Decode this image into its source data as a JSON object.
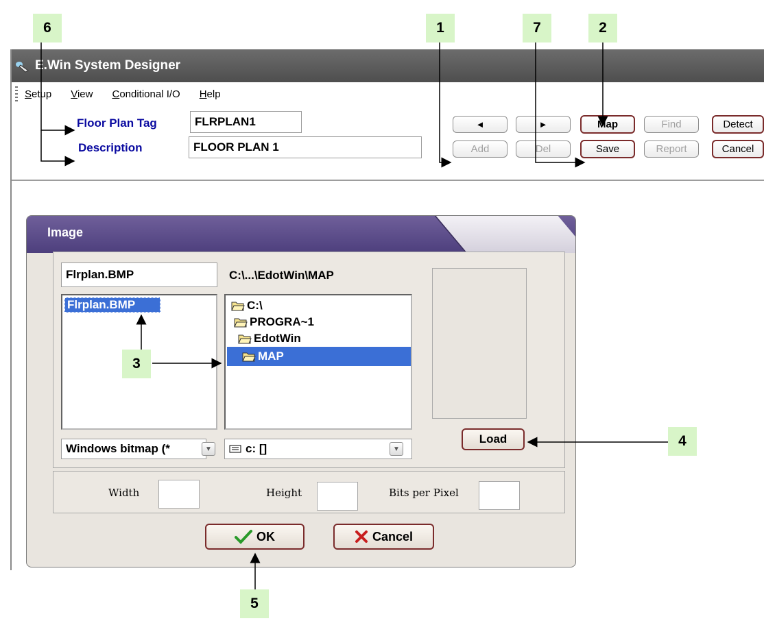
{
  "app": {
    "title": "E.Win System Designer",
    "menu": [
      {
        "ul": "S",
        "rest": "etup"
      },
      {
        "ul": "V",
        "rest": "iew"
      },
      {
        "ul": "C",
        "rest": "onditional I/O"
      },
      {
        "ul": "H",
        "rest": "elp"
      }
    ]
  },
  "form": {
    "floor_plan_tag_label": "Floor Plan Tag",
    "floor_plan_tag_value": "FLRPLAN1",
    "description_label": "Description",
    "description_value": "FLOOR PLAN 1"
  },
  "toolbar": {
    "prev": "◄",
    "next": "►",
    "map": "Map",
    "find": "Find",
    "detect": "Detect",
    "add": "Add",
    "del": "Del",
    "save": "Save",
    "report": "Report",
    "cancel": "Cancel"
  },
  "dialog": {
    "title": "Image",
    "filename_value": "Flrplan.BMP",
    "current_path": "C:\\...\\EdotWin\\MAP",
    "files": [
      "Flrplan.BMP"
    ],
    "folders": [
      "C:\\",
      "PROGRA~1",
      "EdotWin",
      "MAP"
    ],
    "file_type": "Windows bitmap (*",
    "drive": "c: []",
    "load_label": "Load",
    "width_label": "Width",
    "height_label": "Height",
    "bpp_label": "Bits per Pixel",
    "ok_label": "OK",
    "cancel_label": "Cancel"
  },
  "callouts": [
    "1",
    "2",
    "3",
    "4",
    "5",
    "6",
    "7"
  ],
  "colors": {
    "callout_bg": "#d8f5c8",
    "label_blue": "#0a0aa0",
    "selection": "#3b6fd6",
    "dialog_header": "#5a4a8a",
    "ok_green": "#2a9a2a",
    "cancel_red": "#c81e1e"
  }
}
